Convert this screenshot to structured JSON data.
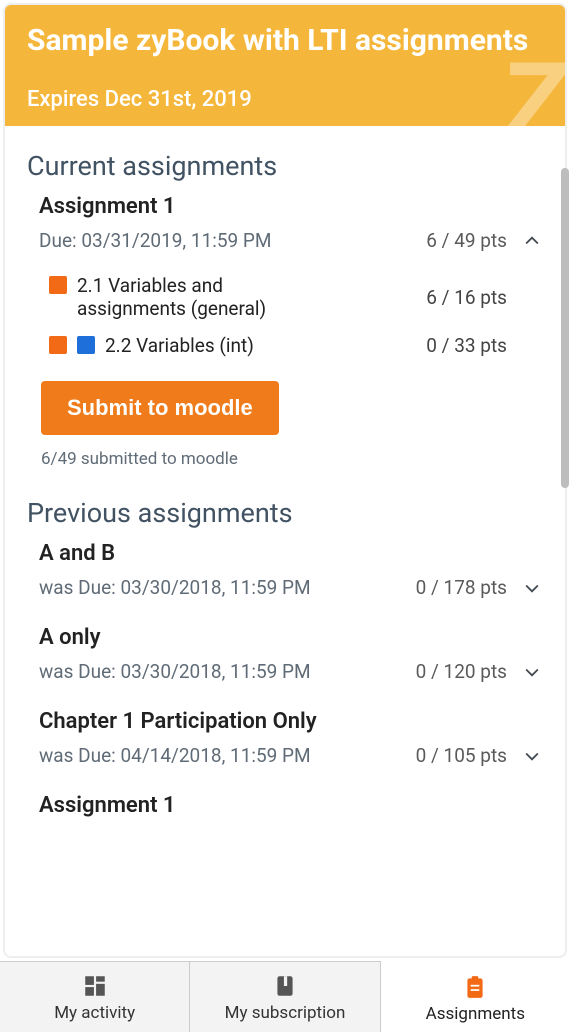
{
  "header": {
    "title": "Sample zyBook with LTI assignments",
    "expiry": "Expires Dec 31st, 2019"
  },
  "current": {
    "section_title": "Current assignments",
    "assignments": [
      {
        "title": "Assignment 1",
        "due": "Due: 03/31/2019, 11:59 PM",
        "pts": "6 / 49 pts",
        "subsections": [
          {
            "label": "2.1 Variables and assignments (general)",
            "pts": "6 / 16 pts",
            "tags": [
              "orange"
            ]
          },
          {
            "label": "2.2 Variables (int)",
            "pts": "0 / 33 pts",
            "tags": [
              "orange",
              "blue"
            ]
          }
        ],
        "submit_label": "Submit to moodle",
        "submit_status": "6/49 submitted to moodle"
      }
    ]
  },
  "previous": {
    "section_title": "Previous assignments",
    "assignments": [
      {
        "title": "A and B",
        "due": "was Due: 03/30/2018, 11:59 PM",
        "pts": "0 / 178 pts"
      },
      {
        "title": "A only",
        "due": "was Due: 03/30/2018, 11:59 PM",
        "pts": "0 / 120 pts"
      },
      {
        "title": "Chapter 1 Participation Only",
        "due": "was Due: 04/14/2018, 11:59 PM",
        "pts": "0 / 105 pts"
      },
      {
        "title": "Assignment 1",
        "due": "",
        "pts": ""
      }
    ]
  },
  "tabs": {
    "activity": "My activity",
    "subscription": "My subscription",
    "assignments": "Assignments"
  }
}
